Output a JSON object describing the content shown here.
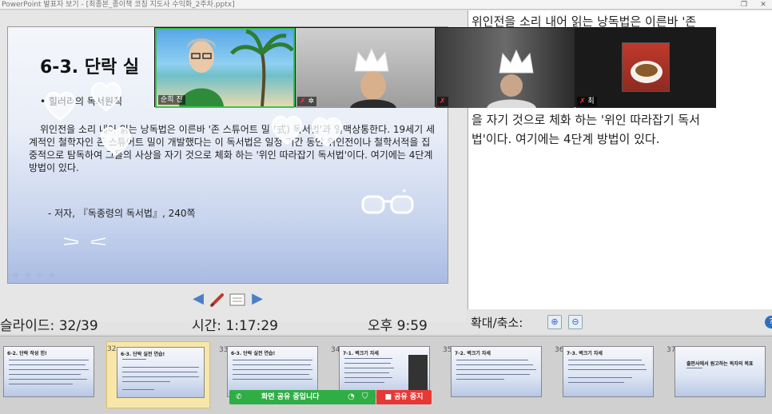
{
  "window": {
    "title": "PowerPoint 발표자 보기 - [최종본_종이책 코칭 지도사 수익화_2주차.pptx]"
  },
  "slide": {
    "title": "6-3. 단락 실",
    "bullet": "• 힐러리의 독서원칙",
    "body": "위인전을 소리 내어 읽는 낭독법은 이른바 '존 스튜어트 밀 (式) 독서법'과 일맥상통한다. 19세기 세계적인 철학자인 존 스튜어트 밀이 개발했다는 이 독서법은 일정 기간 동안 위인전이나 철학서적을 집중적으로 탐독하여 그들의 사상을 자기 것으로 체화 하는 '위인 따라잡기 독서법'이다. 여기에는 4단계 방법이 있다.",
    "reference": "- 저자, 『독종령의 독서법』, 240쪽"
  },
  "status": {
    "slide_counter": "슬라이드: 32/39",
    "elapsed": "시간: 1:17:29",
    "clock": "오후 9:59"
  },
  "notes": {
    "text": "위인전을 소리 내어 읽는 낭독법은 이른바 '존\n통한다. 미\n밀이 개발\n위인전이나\n들의 사상\n을 자기 것으로 체화 하는 '위인 따라잡기 독서\n법'이다. 여기에는 4단계 방법이 있다."
  },
  "zoom": {
    "label": "확대/축소:"
  },
  "video": {
    "participants": [
      {
        "name": "순희 진"
      },
      {
        "name": ""
      },
      {
        "name": ""
      },
      {
        "name": "최"
      }
    ]
  },
  "thumbnails": [
    {
      "num": "",
      "title": "6-2. 단락 작성 힌!"
    },
    {
      "num": "32",
      "title": "6-3. 단락 실전 연습!"
    },
    {
      "num": "33",
      "title": "6-3. 단락 실전 연습!"
    },
    {
      "num": "34",
      "title": "7-1. 벽크기 자세"
    },
    {
      "num": "35",
      "title": "7-2. 벽크기 자세"
    },
    {
      "num": "36",
      "title": "7-3. 벽크기 자세"
    },
    {
      "num": "37",
      "title": "출판사에서 원고하는 독자의 목표"
    }
  ],
  "share": {
    "status": "화면 공유 중입니다",
    "stop": "공유 중지"
  },
  "colors": {
    "share_green": "#2fae45",
    "stop_red": "#e53935",
    "nav_blue": "#4a7fc7",
    "selected_thumb": "#f8e7a8"
  }
}
